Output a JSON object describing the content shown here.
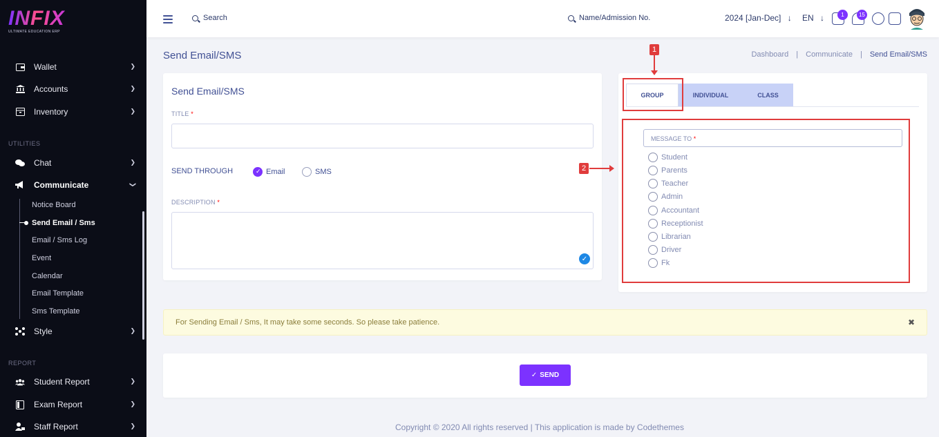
{
  "brand": {
    "name": "INFIX",
    "tagline": "ULTIMATE EDUCATION ERP"
  },
  "sidebar": {
    "items": [
      {
        "label": "Wallet",
        "icon": "wallet-icon"
      },
      {
        "label": "Accounts",
        "icon": "bank-icon"
      },
      {
        "label": "Inventory",
        "icon": "inventory-icon"
      }
    ],
    "section_utilities": "UTILITIES",
    "utilities": [
      {
        "label": "Chat",
        "icon": "chat-icon"
      },
      {
        "label": "Communicate",
        "icon": "megaphone-icon"
      }
    ],
    "communicate_sub": [
      "Notice Board",
      "Send Email / Sms",
      "Email / Sms Log",
      "Event",
      "Calendar",
      "Email Template",
      "Sms Template"
    ],
    "style_item": {
      "label": "Style",
      "icon": "style-icon"
    },
    "section_report": "REPORT",
    "reports": [
      {
        "label": "Student Report",
        "icon": "users-icon"
      },
      {
        "label": "Exam Report",
        "icon": "exam-icon"
      },
      {
        "label": "Staff Report",
        "icon": "staff-icon"
      }
    ]
  },
  "header": {
    "search_label": "Search",
    "admission_search_label": "Name/Admission No.",
    "academic_year": "2024 [Jan-Dec]",
    "language": "EN",
    "chat_badge": "1",
    "notification_badge": "15"
  },
  "page": {
    "title": "Send Email/SMS",
    "breadcrumb": [
      "Dashboard",
      "Communicate",
      "Send Email/SMS"
    ]
  },
  "form": {
    "card_title": "Send Email/SMS",
    "title_label": "TITLE",
    "required_mark": "*",
    "send_through_label": "SEND THROUGH",
    "option_email": "Email",
    "option_sms": "SMS",
    "selected": "Email",
    "description_label": "DESCRIPTION"
  },
  "recipients": {
    "tabs": [
      "GROUP",
      "INDIVIDUAL",
      "CLASS"
    ],
    "active_tab": "GROUP",
    "message_to_label": "MESSAGE TO",
    "roles": [
      "Student",
      "Parents",
      "Teacher",
      "Admin",
      "Accountant",
      "Receptionist",
      "Librarian",
      "Driver",
      "Fk"
    ]
  },
  "annotations": {
    "marker1": "1",
    "marker2": "2",
    "color": "#e03c3c"
  },
  "alert": {
    "text": "For Sending Email / Sms, It may take some seconds. So please take patience.",
    "close": "✖"
  },
  "send_button": {
    "icon": "✓",
    "label": "SEND"
  },
  "footer": {
    "text": "Copyright © 2020 All rights reserved | This application is made by Codethemes"
  },
  "colors": {
    "accent": "#7c32ff",
    "sidebar_bg": "#0b0d17",
    "tab_inactive": "#c8d2f7"
  }
}
